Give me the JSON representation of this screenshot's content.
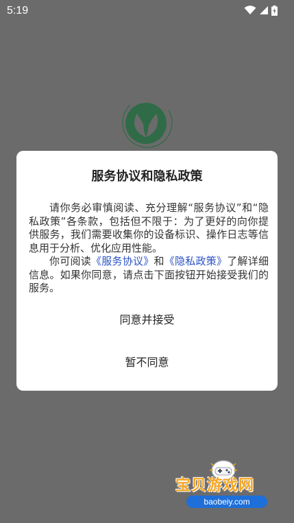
{
  "status_bar": {
    "time": "5:19",
    "icons": [
      "wifi-icon",
      "signal-icon",
      "battery-charging-icon"
    ]
  },
  "app_logo": "leaf-logo",
  "dialog": {
    "title": "服务协议和隐私政策",
    "paragraph1": "请你务必审慎阅读、充分理解“服务协议”和“隐私政策”各条款，包括但不限于：为了更好的向你提供服务，我们需要收集你的设备标识、操作日志等信息用于分析、优化应用性能。",
    "paragraph2": {
      "prefix": "你可阅读",
      "link_service": "《服务协议》",
      "and": "和",
      "link_privacy": "《隐私政策》",
      "suffix": "了解详细信息。如果你同意，请点击下面按钮开始接受我们的服务。"
    },
    "accept_label": "同意并接受",
    "decline_label": "暂不同意"
  },
  "watermark": {
    "brand": "宝贝游戏网",
    "url": "baobeiy.com"
  },
  "colors": {
    "overlay_background": "#6b6b6b",
    "dialog_background": "#ffffff",
    "link": "#2b52c4",
    "logo_green": "#2f6b47",
    "watermark_orange": "#f5a623",
    "watermark_blue": "#1e6fd9"
  }
}
